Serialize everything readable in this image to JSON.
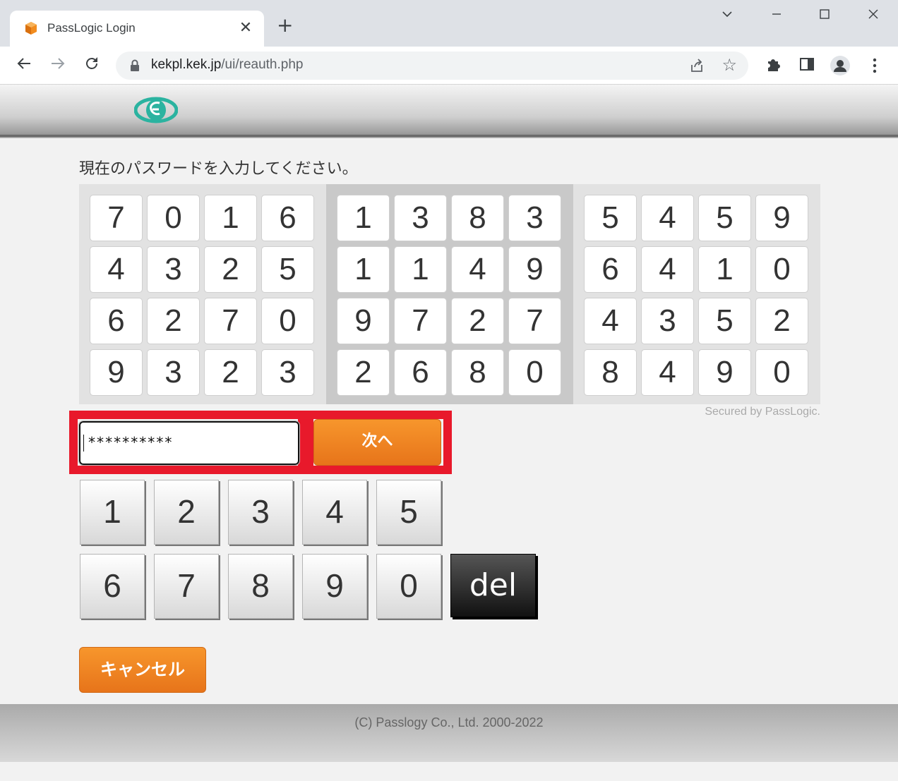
{
  "browser": {
    "tab_title": "PassLogic Login",
    "tab_close": "✕",
    "new_tab": "+",
    "url_host": "kekpl.kek.jp",
    "url_path": "/ui/reauth.php",
    "window_controls": {
      "minimize": "—",
      "maximize": "☐",
      "close": "✕"
    }
  },
  "page": {
    "instruction": "現在のパスワードを入力してください。",
    "matrix": [
      [
        [
          "7",
          "0",
          "1",
          "6"
        ],
        [
          "4",
          "3",
          "2",
          "5"
        ],
        [
          "6",
          "2",
          "7",
          "0"
        ],
        [
          "9",
          "3",
          "2",
          "3"
        ]
      ],
      [
        [
          "1",
          "3",
          "8",
          "3"
        ],
        [
          "1",
          "1",
          "4",
          "9"
        ],
        [
          "9",
          "7",
          "2",
          "7"
        ],
        [
          "2",
          "6",
          "8",
          "0"
        ]
      ],
      [
        [
          "5",
          "4",
          "5",
          "9"
        ],
        [
          "6",
          "4",
          "1",
          "0"
        ],
        [
          "4",
          "3",
          "5",
          "2"
        ],
        [
          "8",
          "4",
          "9",
          "0"
        ]
      ]
    ],
    "secured_text": "Secured by PassLogic.",
    "password_value": "**********",
    "next_label": "次へ",
    "keypad_row1": [
      "1",
      "2",
      "3",
      "4",
      "5"
    ],
    "keypad_row2": [
      "6",
      "7",
      "8",
      "9",
      "0"
    ],
    "del_label": "del",
    "cancel_label": "キャンセル",
    "footer": "(C) Passlogy Co., Ltd. 2000-2022"
  },
  "colors": {
    "accent_orange": "#f08522",
    "highlight_red": "#e8192b",
    "logo_teal": "#2bb3a0"
  }
}
